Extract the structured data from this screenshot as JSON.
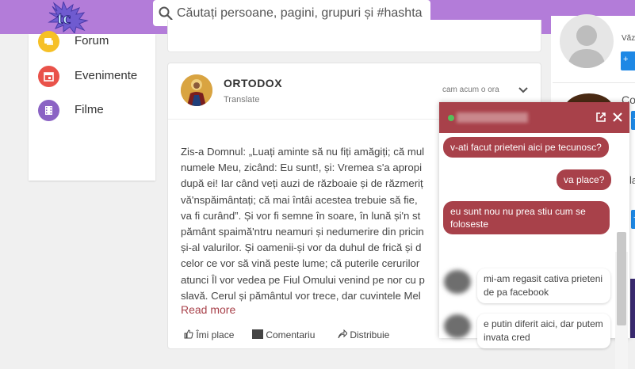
{
  "header": {
    "logo_text": "tc",
    "search_placeholder": "Căutați persoane, pagini, grupuri și #hashtags"
  },
  "sidebar": {
    "items": [
      {
        "label": "Forum",
        "icon": "forum-icon",
        "color": "#f6c026"
      },
      {
        "label": "Evenimente",
        "icon": "calendar-icon",
        "color": "#e9524a"
      },
      {
        "label": "Filme",
        "icon": "film-icon",
        "color": "#8b63c4"
      }
    ]
  },
  "post": {
    "author": "ORTODOX",
    "translate_label": "Translate",
    "time": "cam acum o ora",
    "body_lines": [
      "Zis-a Domnul: „Luați aminte să nu fiți amăgiți; că mul",
      "numele Meu, zicând: Eu sunt!, și: Vremea s'a apropi",
      "după ei! Iar când veți auzi de războaie și de răzmeriț",
      "vă'nspăimântați; că mai întâi acestea trebuie să fie, ",
      "va fi curând”. Și vor fi semne în soare, în lună și'n st",
      "pământ spaimă'ntru neamuri și nedumerire din pricin",
      "și-al valurilor. Și oamenii-și vor da duhul de frică și d",
      "celor ce vor să vină peste lume; că puterile cerurilor",
      "atunci Îl vor vedea pe Fiul Omului venind pe nor cu p",
      "slavă. Cerul și pământul vor trece, dar cuvintele Mel"
    ],
    "read_more": "Read more",
    "actions": {
      "like": "Îmi place",
      "comment": "Comentariu",
      "share": "Distribuie"
    }
  },
  "right": {
    "texts": [
      "Văz",
      "Co",
      "la"
    ],
    "buttons": [
      "+",
      "+",
      "+"
    ]
  },
  "chat": {
    "status_color": "#55c05a",
    "messages": [
      {
        "dir": "out",
        "text": "v-ati facut prieteni aici pe tecunosc?"
      },
      {
        "dir": "out",
        "text": "va place?"
      },
      {
        "dir": "out",
        "text": "eu sunt nou nu prea stiu cum se foloseste"
      },
      {
        "dir": "in",
        "text": "mi-am regasit cativa prieteni de pa facebook"
      },
      {
        "dir": "in",
        "text": "e putin diferit aici, dar putem invata cred"
      }
    ]
  }
}
